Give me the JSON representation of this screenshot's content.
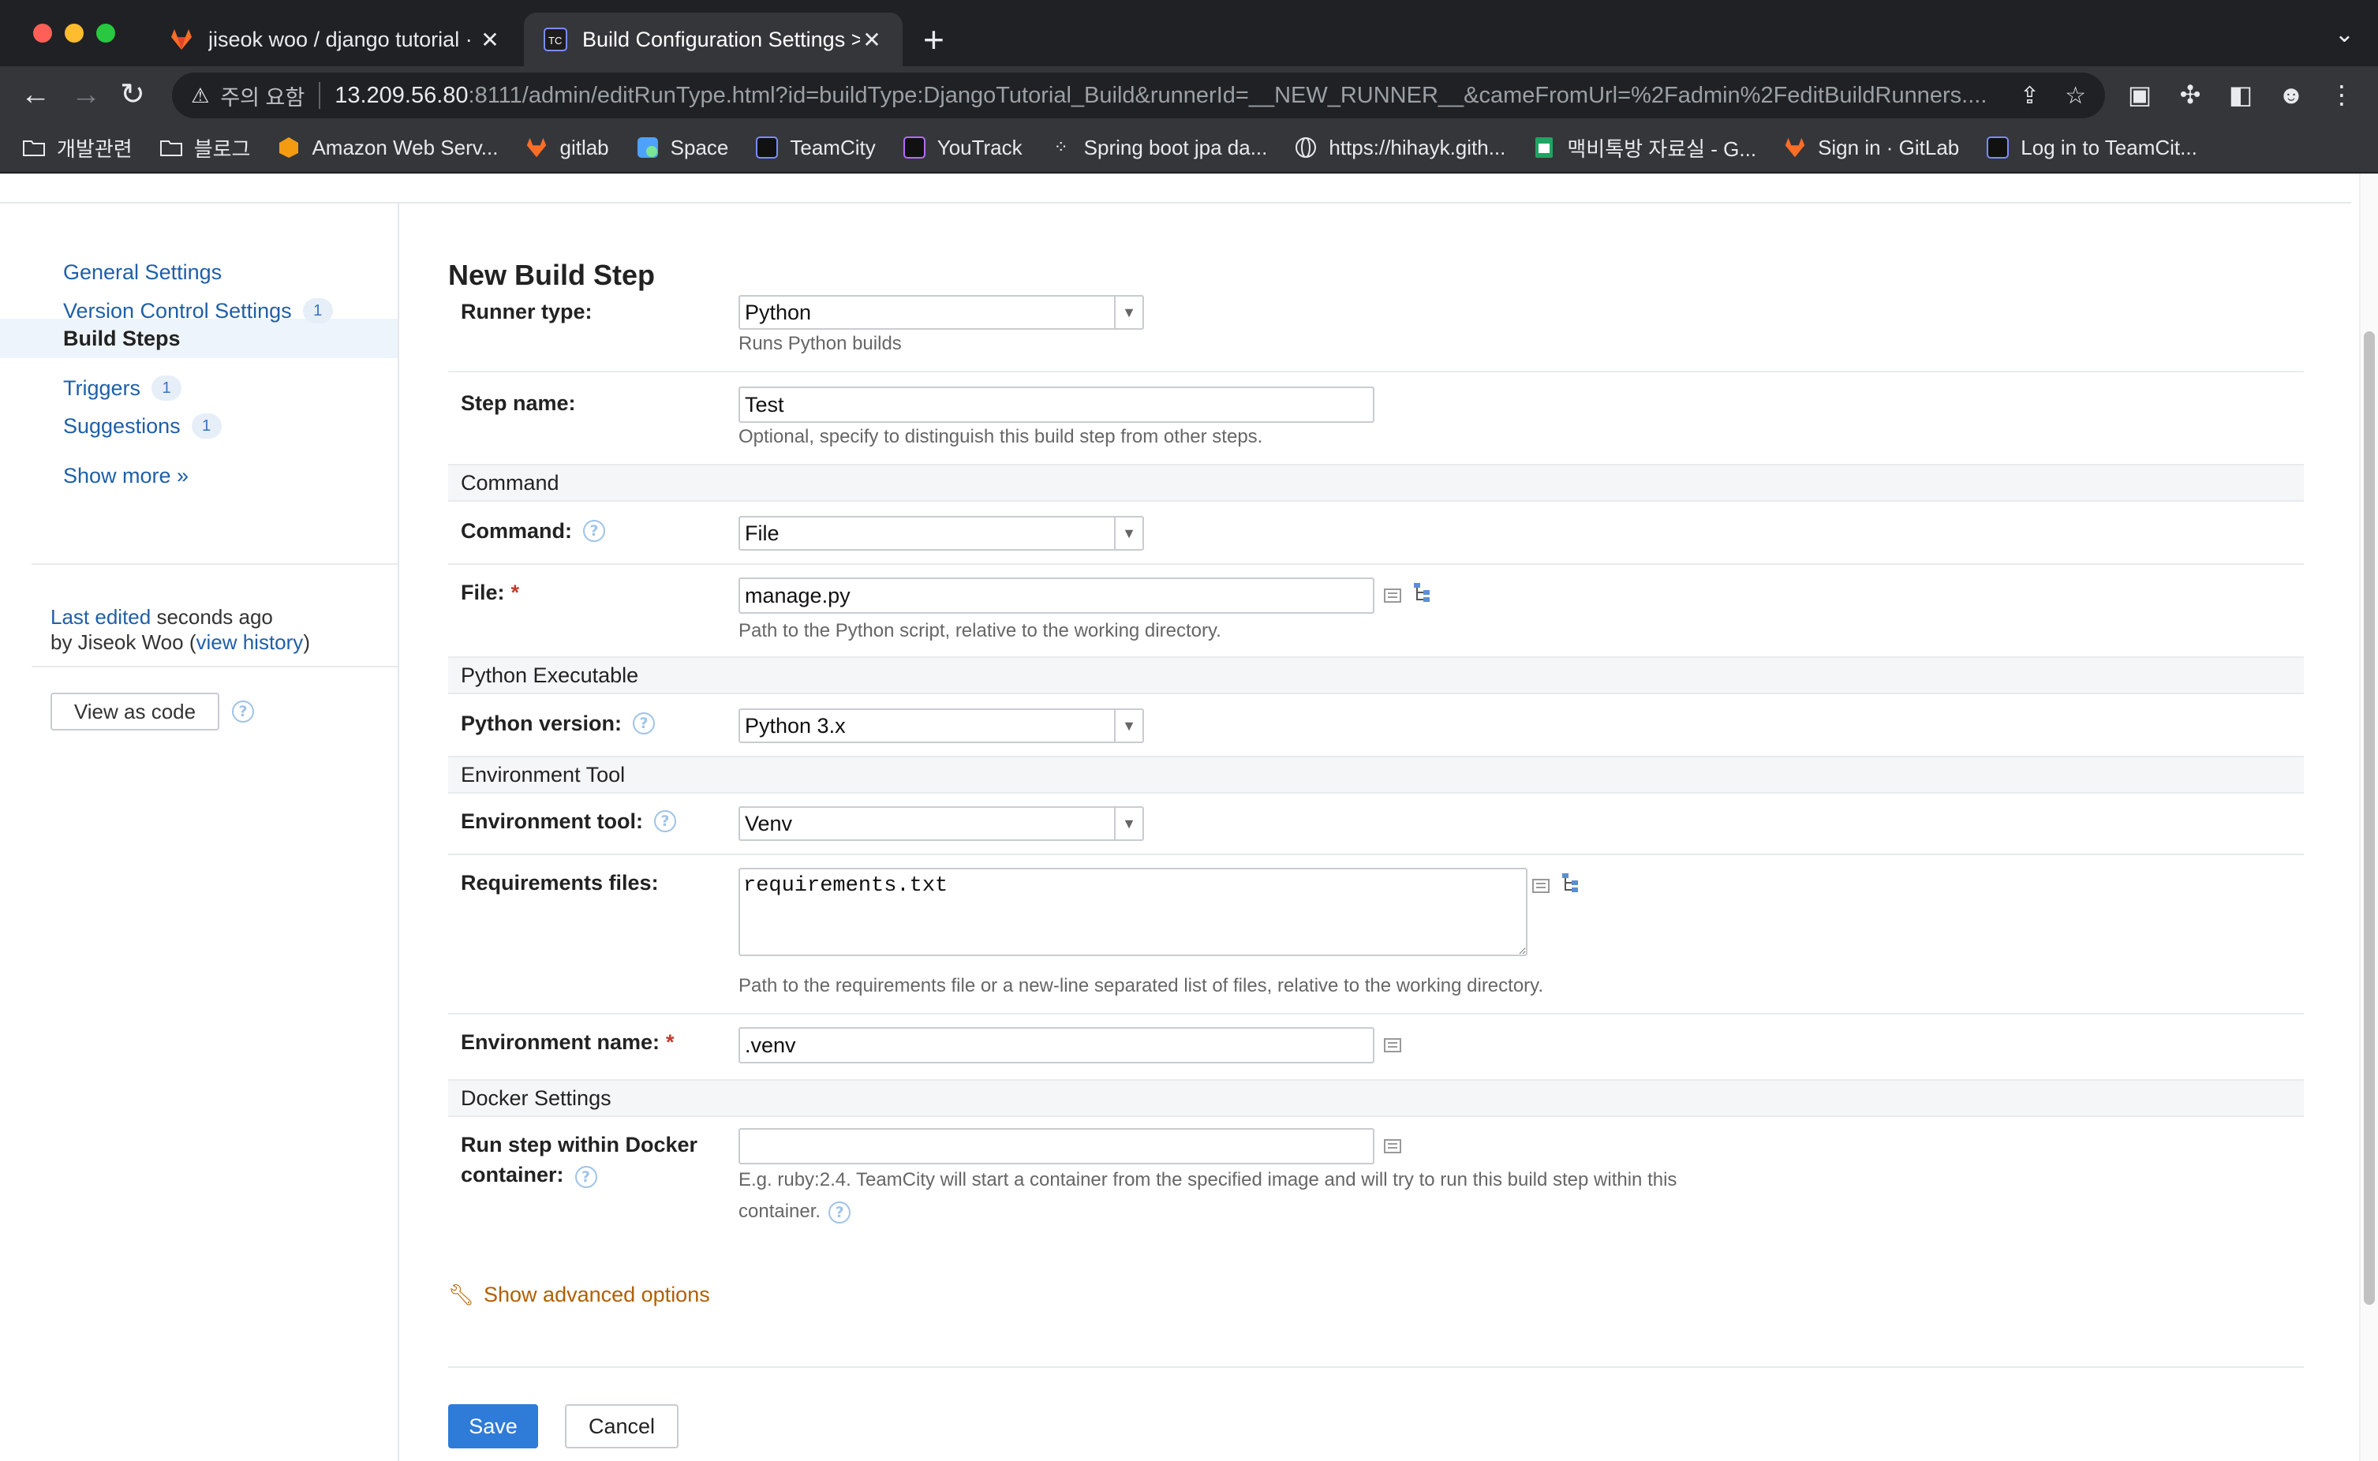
{
  "browser": {
    "tabs": [
      {
        "title": "jiseok woo / django tutorial · Gi"
      },
      {
        "title": "Build Configuration Settings > "
      }
    ],
    "new_tab": "+",
    "address": {
      "security": "주의 요함",
      "host": "13.209.56.80",
      "rest": ":8111/admin/editRunType.html?id=buildType:DjangoTutorial_Build&runnerId=__NEW_RUNNER__&cameFromUrl=%2Fadmin%2FeditBuildRunners...."
    },
    "bookmarks": [
      {
        "label": "개발관련",
        "icon": "folder-icon"
      },
      {
        "label": "블로그",
        "icon": "folder-icon"
      },
      {
        "label": "Amazon Web Serv...",
        "icon": "aws-icon"
      },
      {
        "label": "gitlab",
        "icon": "gitlab-icon"
      },
      {
        "label": "Space",
        "icon": "space-icon"
      },
      {
        "label": "TeamCity",
        "icon": "teamcity-icon"
      },
      {
        "label": "YouTrack",
        "icon": "youtrack-icon"
      },
      {
        "label": "Spring boot jpa da...",
        "icon": "dots-icon"
      },
      {
        "label": "https://hihayk.gith...",
        "icon": "globe-icon"
      },
      {
        "label": "맥비톡방 자료실 - G...",
        "icon": "sheets-icon"
      },
      {
        "label": "Sign in · GitLab",
        "icon": "gitlab-icon"
      },
      {
        "label": "Log in to TeamCit...",
        "icon": "teamcity-icon"
      }
    ]
  },
  "sidebar": {
    "items": [
      {
        "label": "General Settings",
        "badge": ""
      },
      {
        "label": "Version Control Settings",
        "badge": "1"
      },
      {
        "label": "Build Steps",
        "badge": ""
      },
      {
        "label": "Triggers",
        "badge": "1"
      },
      {
        "label": "Suggestions",
        "badge": "1"
      },
      {
        "label": "Show more »",
        "badge": ""
      }
    ],
    "last_edited_link": "Last edited",
    "last_edited_rest": " seconds ago",
    "by_text": "by Jiseok Woo  (",
    "view_history": "view history",
    "close_paren": ")",
    "view_as_code": "View as code"
  },
  "form": {
    "title": "New Build Step",
    "runner_type": {
      "label": "Runner type:",
      "value": "Python",
      "hint": "Runs Python builds"
    },
    "step_name": {
      "label": "Step name:",
      "value": "Test",
      "hint": "Optional, specify to distinguish this build step from other steps."
    },
    "section_command": "Command",
    "command": {
      "label": "Command:",
      "value": "File"
    },
    "file": {
      "label": "File:",
      "required": "*",
      "value": "manage.py",
      "hint": "Path to the Python script, relative to the working directory."
    },
    "section_python": "Python Executable",
    "python_version": {
      "label": "Python version:",
      "value": "Python 3.x"
    },
    "section_env": "Environment Tool",
    "env_tool": {
      "label": "Environment tool:",
      "value": "Venv"
    },
    "requirements": {
      "label": "Requirements files:",
      "value": "requirements.txt",
      "hint": "Path to the requirements file or a new-line separated list of files, relative to the working directory."
    },
    "env_name": {
      "label": "Environment name:",
      "required": "*",
      "value": ".venv"
    },
    "section_docker": "Docker Settings",
    "docker": {
      "label_line1": "Run step within Docker",
      "label_line2": "container:",
      "value": "",
      "hint_line1": "E.g. ruby:2.4. TeamCity will start a container from the specified image and will try to run this build step within this",
      "hint_line2": "container."
    },
    "advanced": "Show advanced options",
    "save": "Save",
    "cancel": "Cancel"
  },
  "colors": {
    "link": "#1f5fa8",
    "accent_button": "#2f7bd8",
    "advanced_link": "#b25f00",
    "required": "#c0392b"
  }
}
